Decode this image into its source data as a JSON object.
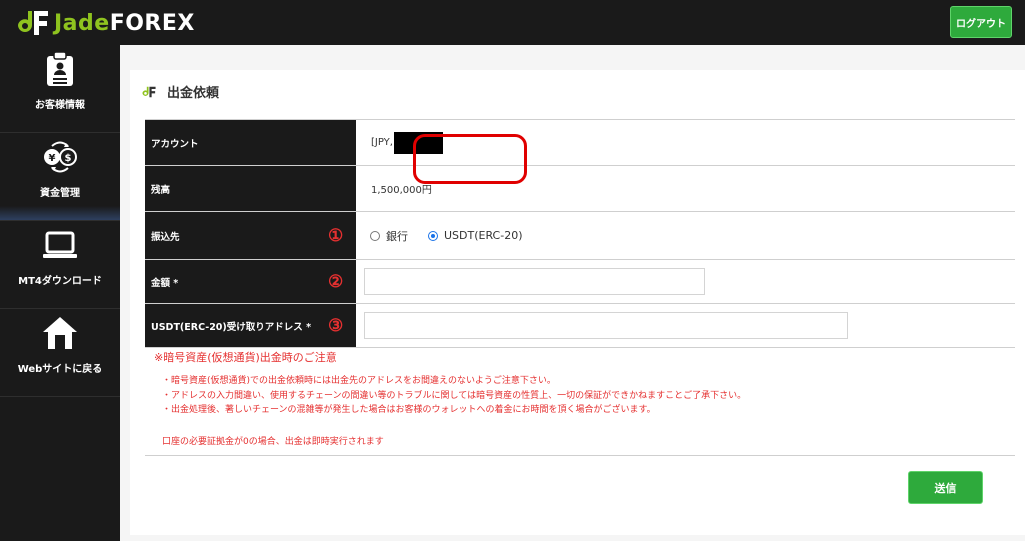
{
  "header": {
    "logo_jade": "Jade",
    "logo_forex": "FOREX",
    "logout_label": "ログアウト"
  },
  "sidebar": {
    "items": [
      {
        "label": "お客様情報",
        "icon": "clipboard-icon"
      },
      {
        "label": "資金管理",
        "icon": "currency-exchange-icon",
        "active": true
      },
      {
        "label": "MT4ダウンロード",
        "icon": "laptop-icon"
      },
      {
        "label": "Webサイトに戻る",
        "icon": "home-icon"
      }
    ]
  },
  "page": {
    "title": "出金依頼"
  },
  "form": {
    "account": {
      "label": "アカウント",
      "value_prefix": "[JPY,"
    },
    "balance": {
      "label": "残高",
      "value": "1,500,000円"
    },
    "destination": {
      "label": "振込先",
      "marker": "①",
      "options": [
        {
          "label": "銀行",
          "selected": false
        },
        {
          "label": "USDT(ERC-20)",
          "selected": true
        }
      ]
    },
    "amount": {
      "label": "金額 *",
      "marker": "②",
      "value": ""
    },
    "usdt_address": {
      "label": "USDT(ERC-20)受け取りアドレス *",
      "marker": "③",
      "value": ""
    }
  },
  "notes": {
    "heading": "※暗号資産(仮想通貨)出金時のご注意",
    "items": [
      "・暗号資産(仮想通貨)での出金依頼時には出金先のアドレスをお間違えのないようご注意下さい。",
      "・アドレスの入力間違い、使用するチェーンの間違い等のトラブルに関しては暗号資産の性質上、一切の保証ができかねますことご了承下さい。",
      "・出金処理後、著しいチェーンの混雑等が発生した場合はお客様のウォレットへの着金にお時間を頂く場合がございます。"
    ],
    "footer": "口座の必要証拠金が0の場合、出金は即時実行されます"
  },
  "submit_label": "送信",
  "colors": {
    "accent_green": "#2eaa3c",
    "logo_green": "#8fc31f",
    "alert_red": "#e53030",
    "highlight_red": "#e00000",
    "radio_blue": "#1a73e8",
    "dark": "#1a1a1a"
  }
}
